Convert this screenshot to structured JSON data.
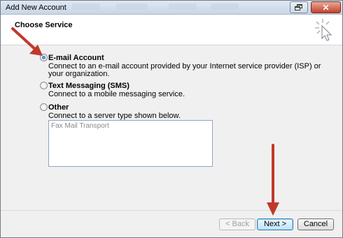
{
  "window": {
    "title": "Add New Account"
  },
  "header": {
    "heading": "Choose Service"
  },
  "options": [
    {
      "label": "E-mail Account",
      "selected": true,
      "desc": [
        "Connect to an e-mail account provided by your Internet service provider (ISP) or",
        "your organization."
      ]
    },
    {
      "label": "Text Messaging (SMS)",
      "selected": false,
      "desc": [
        "Connect to a mobile messaging service."
      ]
    },
    {
      "label": "Other",
      "selected": false,
      "desc": [
        "Connect to a server type shown below."
      ]
    }
  ],
  "server_types": {
    "items": [
      "Fax Mail Transport"
    ]
  },
  "buttons": {
    "back": "< Back",
    "next": "Next >",
    "cancel": "Cancel"
  },
  "annotation_color": "#c0392b"
}
